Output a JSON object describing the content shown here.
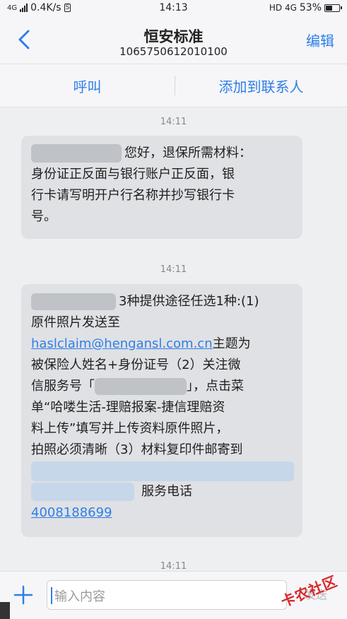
{
  "status_bar": {
    "network": "4G",
    "speed": "0.4K/s",
    "sim": "S",
    "time": "14:13",
    "right_net": "HD 4G",
    "battery": "53%",
    "battery_level": 0.53
  },
  "header": {
    "title": "恒安标准",
    "number": "1065750612010100",
    "edit_label": "编辑"
  },
  "actions": {
    "call_label": "呼叫",
    "add_contact_label": "添加到联系人"
  },
  "messages": [
    {
      "time": "14:11",
      "line1": "您好，退保所需材料：",
      "line2": "身份证正反面与银行账户正反面，银",
      "line3": "行卡请写明开户行名称并抄写银行卡",
      "line4": "号。"
    },
    {
      "time": "14:11",
      "line1": "3种提供途径任选1种:(1)",
      "line2": "原件照片发送至",
      "email": "haslclaim@hengansl.com.cn",
      "line3": "主题为",
      "line4": "被保险人姓名+身份证号（2）关注微",
      "line5a": "信服务号「",
      "line5b": "」，点击菜",
      "line6": "单“哈喽生活-理赔报案-捷信理赔资",
      "line7": "料上传”填写并上传资料原件照片，",
      "line8": "拍照必须清晰（3）材料复印件邮寄到",
      "line10": "服务电话",
      "phone": "4008188699"
    },
    {
      "time": "14:11"
    }
  ],
  "input": {
    "placeholder": "输入内容",
    "send_label": "发送"
  },
  "watermark": "卡农社区",
  "colors": {
    "accent": "#2f7ee8",
    "bubble": "#dfe1e4",
    "background": "#eeeff1"
  }
}
